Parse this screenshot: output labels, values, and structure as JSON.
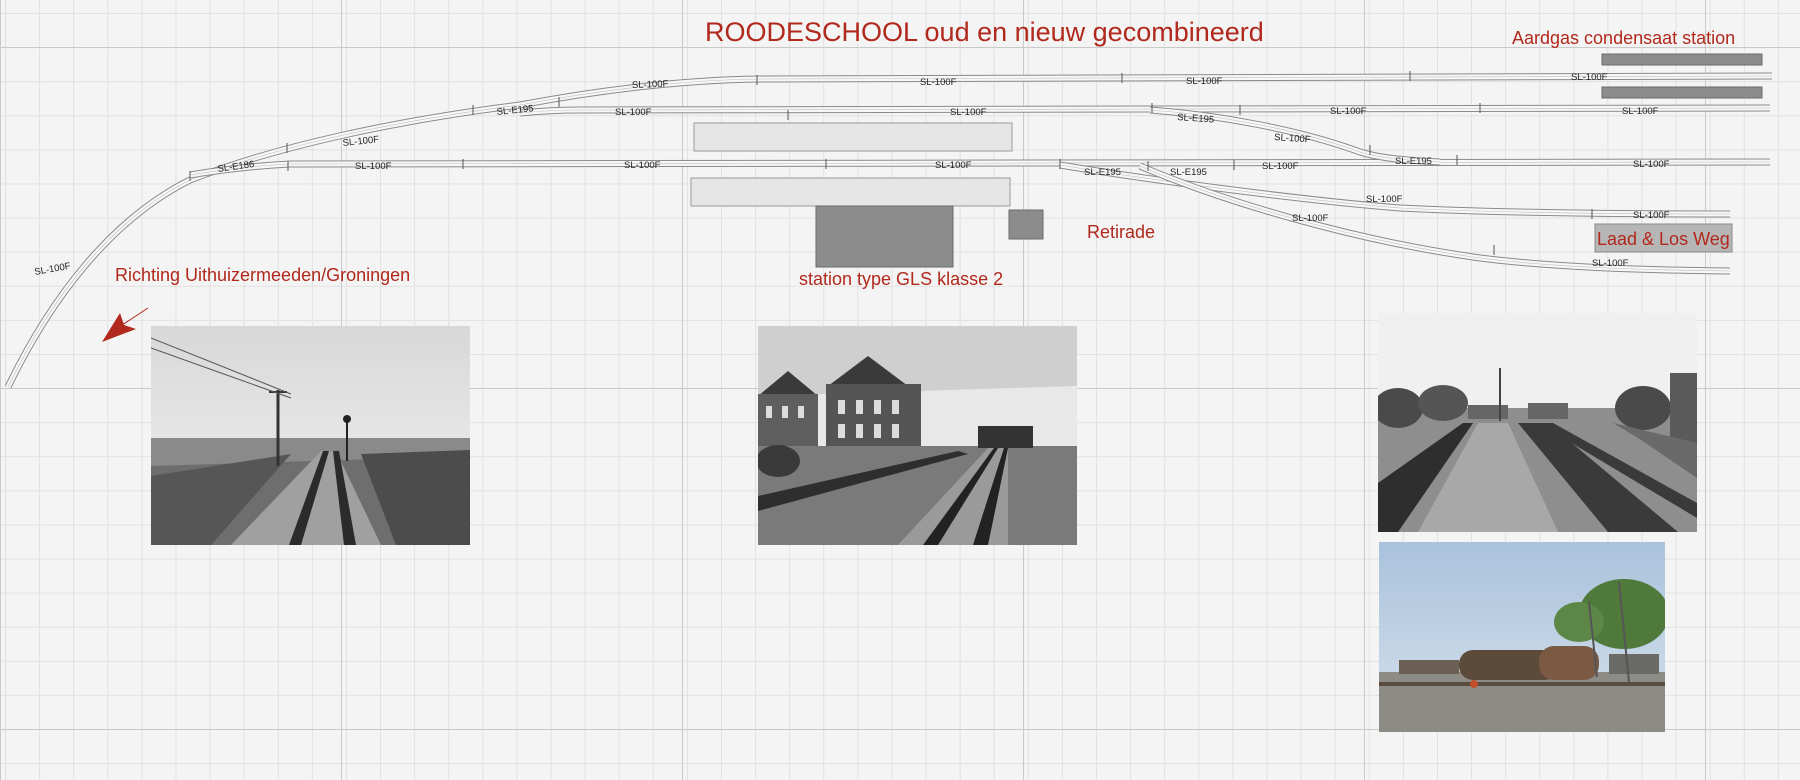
{
  "title": "ROODESCHOOL oud en nieuw gecombineerd",
  "labels": {
    "gas_station": "Aardgas condensaat station",
    "direction": "Richting Uithuizermeeden/Groningen",
    "station": "station type GLS klasse 2",
    "retirade": "Retirade",
    "loading_road": "Laad & Los Weg"
  },
  "track_labels": {
    "sl100f": "SL-100F",
    "sle195": "SL-E195",
    "sle186": "SL-E186"
  },
  "colors": {
    "label_red": "#b1281c",
    "track": "#8a8a8a",
    "building_dark": "#8c8c8c",
    "platform_light": "#e6e6e6"
  },
  "photos": [
    {
      "name": "photo-level-crossing",
      "subject": "level crossing with signal and telegraph poles"
    },
    {
      "name": "photo-station-building",
      "subject": "brick station building with goods train"
    },
    {
      "name": "photo-station-tracks",
      "subject": "station tracks with switches"
    },
    {
      "name": "photo-tank-wagons",
      "subject": "tank wagons at condensate station"
    }
  ]
}
